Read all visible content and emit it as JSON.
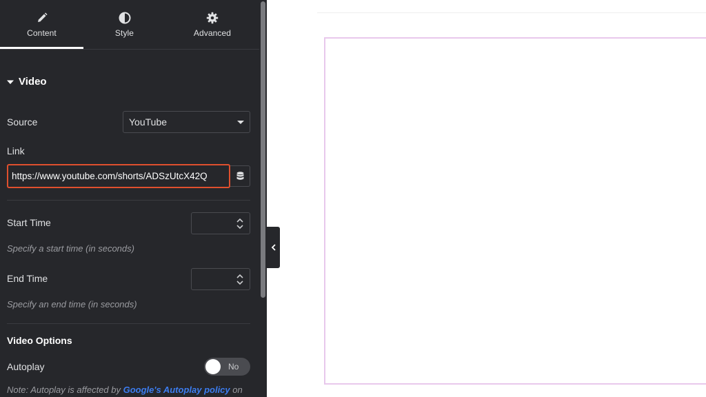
{
  "tabs": [
    {
      "label": "Content",
      "icon": "pencil-icon",
      "active": true
    },
    {
      "label": "Style",
      "icon": "half-circle-icon",
      "active": false
    },
    {
      "label": "Advanced",
      "icon": "gear-icon",
      "active": false
    }
  ],
  "section": {
    "title": "Video"
  },
  "source": {
    "label": "Source",
    "value": "YouTube"
  },
  "link": {
    "label": "Link",
    "value": "https://www.youtube.com/shorts/ADSzUtcX42Q"
  },
  "start_time": {
    "label": "Start Time",
    "value": "",
    "help": "Specify a start time (in seconds)"
  },
  "end_time": {
    "label": "End Time",
    "value": "",
    "help": "Specify an end time (in seconds)"
  },
  "video_options": {
    "title": "Video Options"
  },
  "autoplay": {
    "label": "Autoplay",
    "toggle_text": "No",
    "enabled": false
  },
  "note": {
    "prefix": "Note: Autoplay is affected by ",
    "link_text": "Google's Autoplay policy",
    "suffix": " on"
  },
  "colors": {
    "panel_bg": "#26272b",
    "highlight": "#e0502e",
    "link": "#3c7df0",
    "preview_border": "#e8c8ec"
  }
}
